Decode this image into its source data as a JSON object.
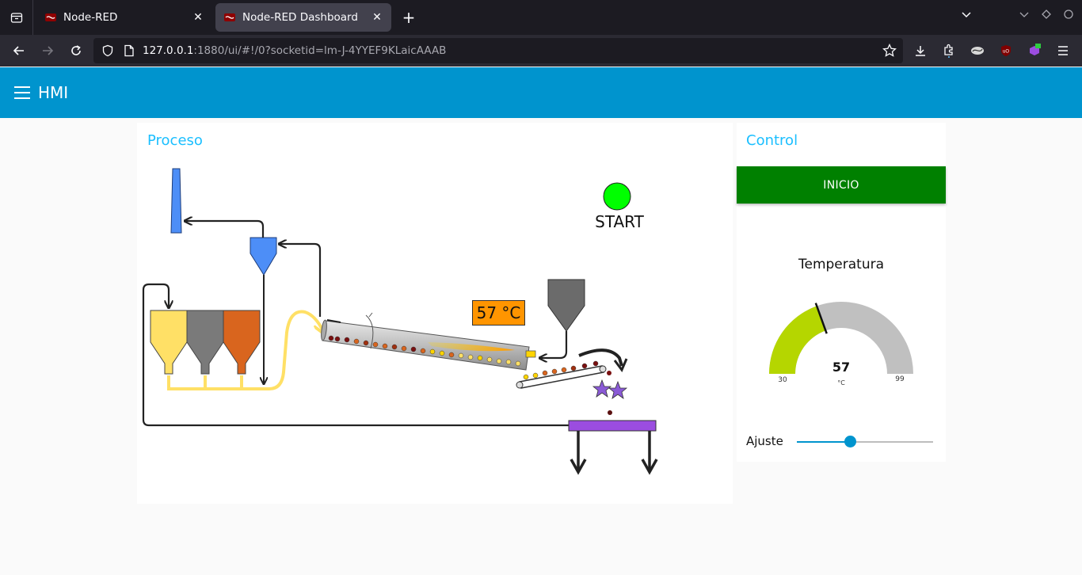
{
  "browser": {
    "tabs": [
      {
        "title": "Node-RED",
        "active": false
      },
      {
        "title": "Node-RED Dashboard",
        "active": true
      }
    ],
    "url": {
      "host": "127.0.0.1",
      "rest": ":1880/ui/#!/0?socketid=lm-J-4YYEF9KLaicAAAB"
    }
  },
  "app": {
    "title": "HMI",
    "accent_color": "#0094ce"
  },
  "proceso": {
    "title": "Proceso",
    "temperature_label": "57 °C",
    "start_label": "START",
    "start_indicator_color": "#00ff00"
  },
  "control": {
    "title": "Control",
    "button_label": "INICIO",
    "button_color": "#008000",
    "gauge": {
      "title": "Temperatura",
      "value": "57",
      "unit": "°C",
      "min": "30",
      "max": "99",
      "value_fraction": 0.39,
      "fill_color": "#b5d600",
      "track_color": "#c0c0c0"
    },
    "slider": {
      "label": "Ajuste",
      "value_fraction": 0.39
    }
  }
}
